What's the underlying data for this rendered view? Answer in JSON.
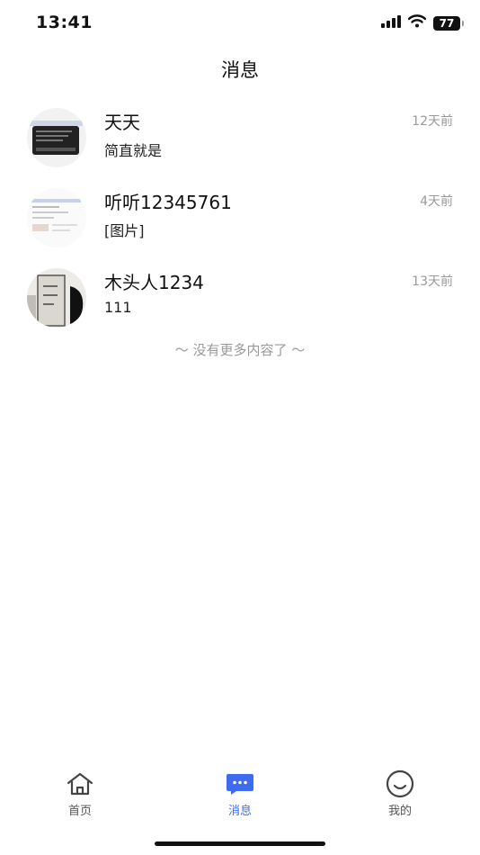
{
  "status": {
    "time": "13:41",
    "battery": "77"
  },
  "header": {
    "title": "消息"
  },
  "messages": [
    {
      "name": "天天",
      "time": "12天前",
      "preview": "简直就是"
    },
    {
      "name": "听听12345761",
      "time": "4天前",
      "preview": "[图片]"
    },
    {
      "name": "木头人1234",
      "time": "13天前",
      "preview": "111"
    }
  ],
  "footer_note": "～ 没有更多内容了 ～",
  "tabs": [
    {
      "label": "首页",
      "icon": "home-icon"
    },
    {
      "label": "消息",
      "icon": "chat-icon"
    },
    {
      "label": "我的",
      "icon": "smile-icon"
    }
  ],
  "colors": {
    "accent": "#3d6cf0",
    "muted": "#9a9a9a"
  }
}
